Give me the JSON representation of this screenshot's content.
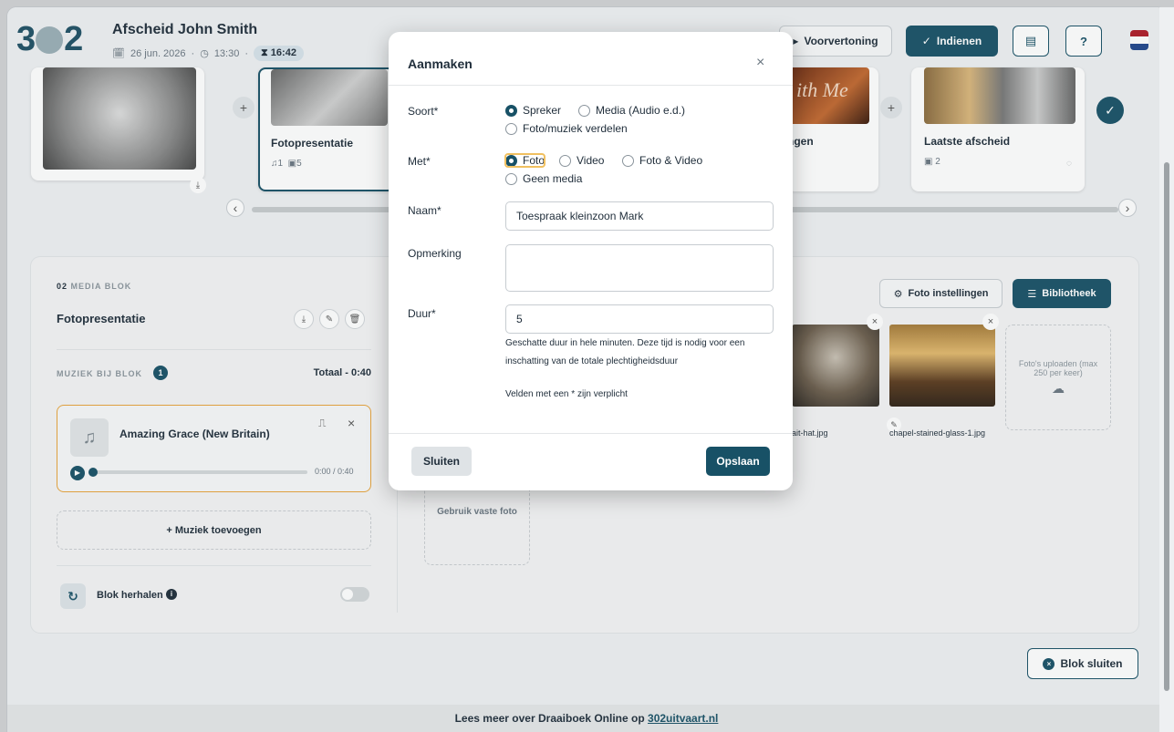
{
  "header": {
    "logo_text": "3",
    "logo_text2": "2",
    "title": "Afscheid John Smith",
    "date": "26 jun. 2026",
    "time": "13:30",
    "duration": "16:42",
    "preview_label": "Voorvertoning",
    "submit_label": "Indienen",
    "help_label": "?"
  },
  "cards": {
    "card1": {
      "title": "Fotopresentatie",
      "music_count": "1",
      "photo_count": "5"
    },
    "card2": {
      "title": "ngen",
      "overlay_text": "ith Me"
    },
    "card3": {
      "title": "Laatste afscheid",
      "photo_count": "2"
    }
  },
  "media_block": {
    "section_no": "02",
    "section_label": "MEDIA BLOK",
    "title": "Fotopresentatie",
    "music_label": "MUZIEK BIJ BLOK",
    "music_badge": "1",
    "total": "Totaal - 0:40",
    "track_title": "Amazing Grace (New Britain)",
    "track_time": "0:00 / 0:40",
    "add_music": "Muziek toevoegen",
    "repeat_label": "Blok herhalen",
    "fixed_photo": "Gebruik vaste foto",
    "photo_settings": "Foto instellingen",
    "library": "Bibliotheek",
    "photo1_name": "ait-hat.jpg",
    "photo2_name": "chapel-stained-glass-1.jpg",
    "upload_text": "Foto's uploaden (max 250 per keer)",
    "close_block": "Blok sluiten"
  },
  "footer": {
    "text": "Lees meer over Draaiboek Online op ",
    "link": "302uitvaart.nl"
  },
  "modal": {
    "title": "Aanmaken",
    "close": "×",
    "soort_label": "Soort*",
    "soort_options": [
      "Spreker",
      "Media (Audio e.d.)",
      "Foto/muziek verdelen"
    ],
    "met_label": "Met*",
    "met_options": [
      "Foto",
      "Video",
      "Foto & Video",
      "Geen media"
    ],
    "naam_label": "Naam*",
    "naam_value": "Toespraak kleinzoon Mark",
    "opmerking_label": "Opmerking",
    "opmerking_value": "",
    "duur_label": "Duur*",
    "duur_value": "5",
    "help_text": "Geschatte duur in hele minuten. Deze tijd is nodig voor een inschatting van de totale plechtigheidsduur",
    "required_note": "Velden met een * zijn verplicht",
    "cancel_label": "Sluiten",
    "save_label": "Opslaan"
  }
}
